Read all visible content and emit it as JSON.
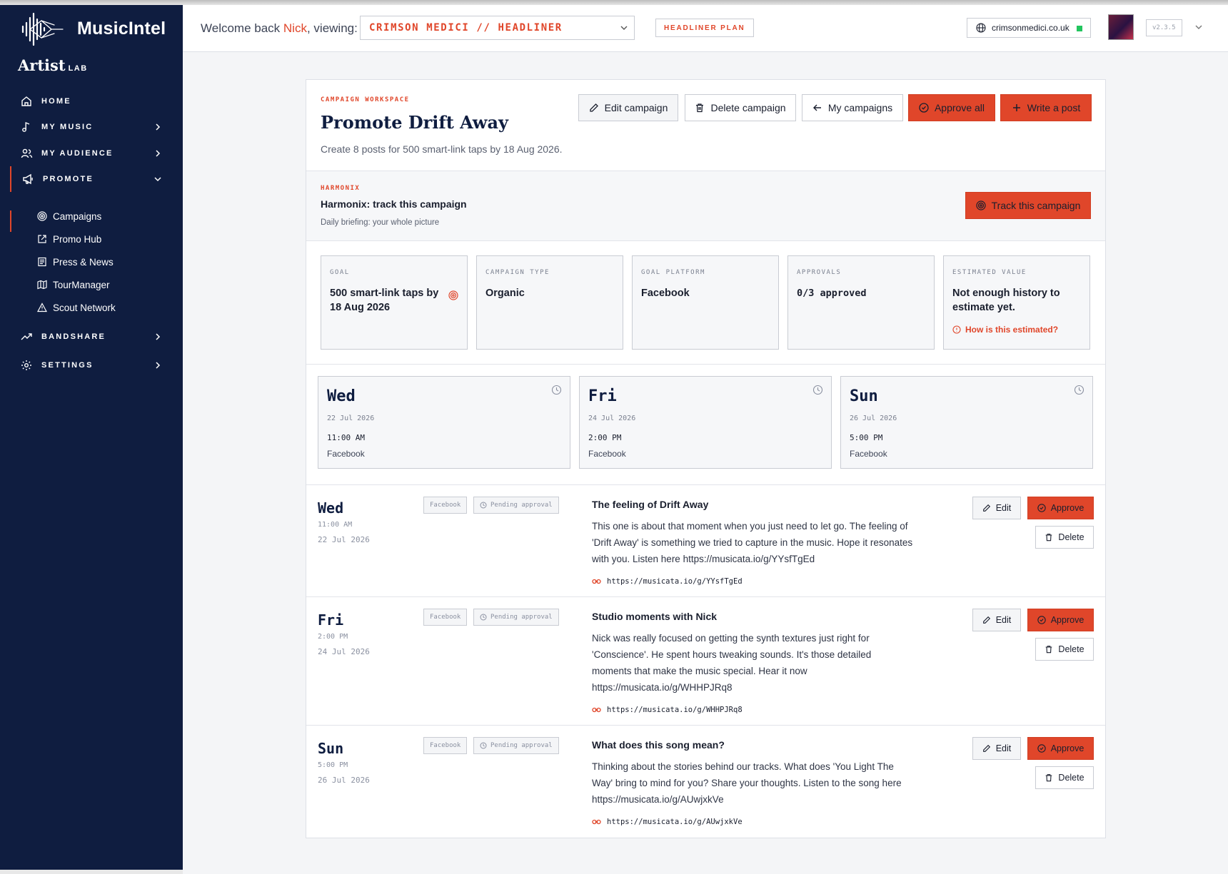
{
  "brand": {
    "name": "MusicIntel",
    "product": "Artist",
    "product_suffix": "LAB"
  },
  "colors": {
    "accent": "#e0462a",
    "sidebar": "#0f1d40",
    "status_dot": "#22c55e"
  },
  "sidebar": {
    "items": [
      {
        "label": "HOME",
        "icon": "home-icon"
      },
      {
        "label": "MY MUSIC",
        "icon": "music-note-icon"
      },
      {
        "label": "MY AUDIENCE",
        "icon": "users-icon"
      },
      {
        "label": "PROMOTE",
        "icon": "megaphone-icon"
      },
      {
        "label": "BANDSHARE",
        "icon": "trending-up-icon"
      },
      {
        "label": "SETTINGS",
        "icon": "gear-icon"
      }
    ],
    "promote_sub": [
      {
        "label": "Campaigns",
        "icon": "target-icon"
      },
      {
        "label": "Promo Hub",
        "icon": "external-link-icon"
      },
      {
        "label": "Press & News",
        "icon": "newspaper-icon"
      },
      {
        "label": "TourManager",
        "icon": "map-icon"
      },
      {
        "label": "Scout Network",
        "icon": "warning-triangle-icon"
      }
    ]
  },
  "header": {
    "welcome_prefix": "Welcome back ",
    "user": "Nick",
    "welcome_suffix": ", viewing:",
    "artist": "CRIMSON MEDICI // HEADLINER",
    "plan": "HEADLINER PLAN",
    "domain": "crimsonmedici.co.uk",
    "version": "v2.3.5"
  },
  "campaign": {
    "eyebrow": "CAMPAIGN WORKSPACE",
    "title": "Promote Drift Away",
    "subtitle": "Create 8 posts for 500 smart-link taps by 18 Aug 2026.",
    "buttons": {
      "edit": "Edit campaign",
      "delete": "Delete campaign",
      "back": "My campaigns",
      "approve_all": "Approve all",
      "write": "Write a post"
    }
  },
  "harmonix": {
    "eyebrow": "HARMONIX",
    "title": "Harmonix: track this campaign",
    "subtitle": "Daily briefing: your whole picture",
    "button": "Track this campaign"
  },
  "stats": [
    {
      "label": "GOAL",
      "value": "500 smart-link taps by 18 Aug 2026"
    },
    {
      "label": "CAMPAIGN TYPE",
      "value": "Organic"
    },
    {
      "label": "GOAL PLATFORM",
      "value": "Facebook"
    },
    {
      "label": "APPROVALS",
      "value": "0/3 approved"
    },
    {
      "label": "ESTIMATED VALUE",
      "value": "Not enough history to estimate yet.",
      "link": "How is this estimated?"
    }
  ],
  "schedule": [
    {
      "day": "Wed",
      "date": "22 Jul 2026",
      "time": "11:00 AM",
      "platform": "Facebook"
    },
    {
      "day": "Fri",
      "date": "24 Jul 2026",
      "time": "2:00 PM",
      "platform": "Facebook"
    },
    {
      "day": "Sun",
      "date": "26 Jul 2026",
      "time": "5:00 PM",
      "platform": "Facebook"
    }
  ],
  "posts": [
    {
      "day": "Wed",
      "time": "11:00 AM",
      "date": "22 Jul 2026",
      "platform": "Facebook",
      "status": "Pending approval",
      "title": "The feeling of Drift Away",
      "body": "This one is about that moment when you just need to let go. The feeling of 'Drift Away' is something we tried to capture in the music. Hope it resonates with you. Listen here https://musicata.io/g/YYsfTgEd",
      "link": "https://musicata.io/g/YYsfTgEd",
      "edit": "Edit",
      "approve": "Approve",
      "delete": "Delete"
    },
    {
      "day": "Fri",
      "time": "2:00 PM",
      "date": "24 Jul 2026",
      "platform": "Facebook",
      "status": "Pending approval",
      "title": "Studio moments with Nick",
      "body": "Nick was really focused on getting the synth textures just right for 'Conscience'. He spent hours tweaking sounds. It's those detailed moments that make the music special. Hear it now https://musicata.io/g/WHHPJRq8",
      "link": "https://musicata.io/g/WHHPJRq8",
      "edit": "Edit",
      "approve": "Approve",
      "delete": "Delete"
    },
    {
      "day": "Sun",
      "time": "5:00 PM",
      "date": "26 Jul 2026",
      "platform": "Facebook",
      "status": "Pending approval",
      "title": "What does this song mean?",
      "body": "Thinking about the stories behind our tracks. What does 'You Light The Way' bring to mind for you? Share your thoughts. Listen to the song here https://musicata.io/g/AUwjxkVe",
      "link": "https://musicata.io/g/AUwjxkVe",
      "edit": "Edit",
      "approve": "Approve",
      "delete": "Delete"
    }
  ]
}
